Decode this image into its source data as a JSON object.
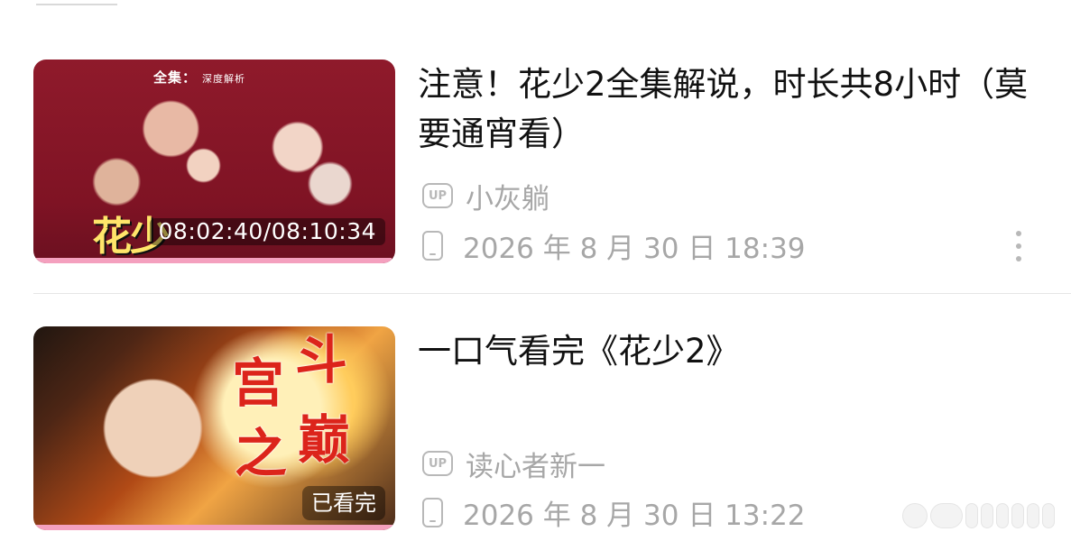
{
  "videos": [
    {
      "thumbnail_label": "全集：",
      "thumbnail_sublabel": "深度解析",
      "thumbnail_text": "花少",
      "timecode": "08:02:40/08:10:34",
      "title": "注意！花少2全集解说，时长共8小时（莫要通宵看）",
      "author": "小灰躺",
      "date": "2026 年 8 月 30 日 18:39",
      "progress_fraction": 0.99,
      "icons": [
        "up-icon",
        "phone-icon",
        "more-icon"
      ]
    },
    {
      "thumbnail_chars": [
        "宫",
        "斗",
        "之",
        "巅"
      ],
      "watched_label": "已看完",
      "title": "一口气看完《花少2》",
      "author": "读心者新一",
      "date": "2026 年 8 月 30 日 13:22",
      "progress_fraction": 1,
      "icons": [
        "up-icon",
        "phone-icon"
      ]
    }
  ],
  "labels": {
    "up_badge": "UP"
  },
  "colors": {
    "background": "#ffffff",
    "title": "#111111",
    "meta": "#a7a7a7",
    "progress": "#f4a0be",
    "thumb_red": "#8f1a2b"
  }
}
